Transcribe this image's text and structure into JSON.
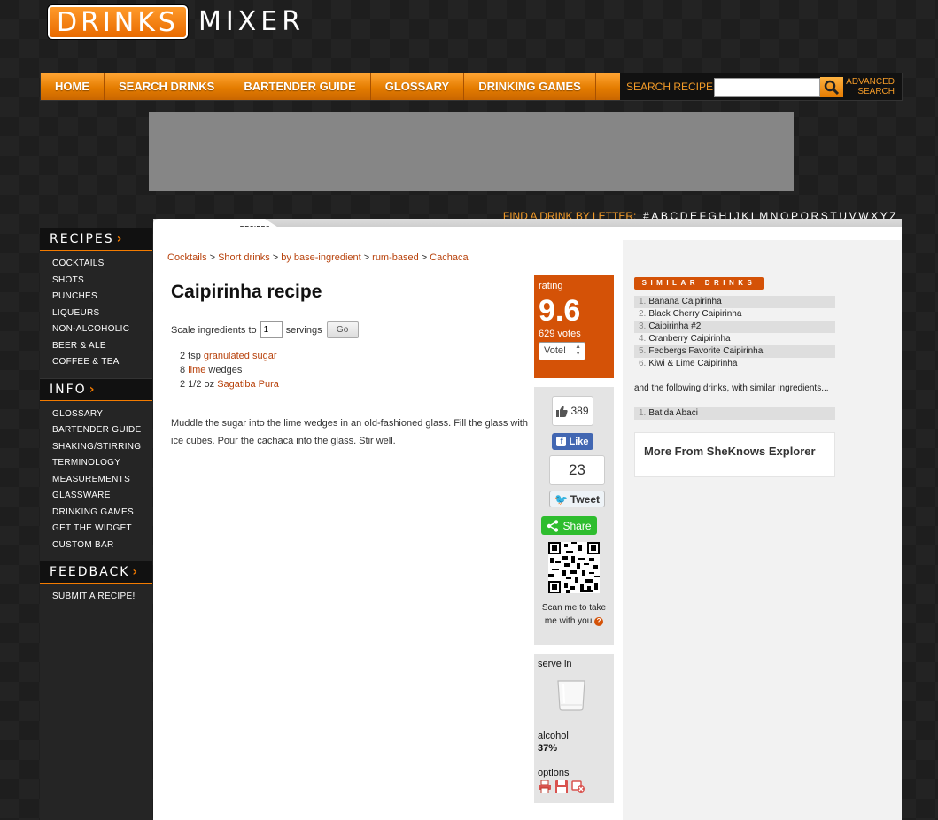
{
  "logo": {
    "part1": "DRINKS",
    "part2": "MIXER"
  },
  "nav": {
    "items": [
      "HOME",
      "SEARCH DRINKS",
      "BARTENDER GUIDE",
      "GLOSSARY",
      "DRINKING GAMES"
    ],
    "search_label": "SEARCH RECIPES",
    "search_placeholder": "",
    "advanced_line1": "ADVANCED",
    "advanced_line2": "SEARCH"
  },
  "letters": {
    "label": "FIND A DRINK BY LETTER:",
    "items": [
      "#",
      "A",
      "B",
      "C",
      "D",
      "E",
      "F",
      "G",
      "H",
      "I",
      "J",
      "K",
      "L",
      "M",
      "N",
      "O",
      "P",
      "Q",
      "R",
      "S",
      "T",
      "U",
      "V",
      "W",
      "X",
      "Y",
      "Z"
    ]
  },
  "sidebar": {
    "recipes": {
      "title": "RECIPES",
      "items": [
        "COCKTAILS",
        "SHOTS",
        "PUNCHES",
        "LIQUEURS",
        "NON-ALCOHOLIC",
        "BEER & ALE",
        "COFFEE & TEA"
      ]
    },
    "info": {
      "title": "INFO",
      "items": [
        "GLOSSARY",
        "BARTENDER GUIDE",
        "SHAKING/STIRRING",
        "TERMINOLOGY",
        "MEASUREMENTS",
        "GLASSWARE",
        "DRINKING GAMES",
        "GET THE WIDGET",
        "CUSTOM BAR"
      ]
    },
    "feedback": {
      "title": "FEEDBACK",
      "items": [
        "SUBMIT A RECIPE!"
      ]
    }
  },
  "tab": {
    "label": "RECIPES"
  },
  "breadcrumb": [
    "Cocktails",
    "Short drinks",
    "by base-ingredient",
    "rum-based",
    "Cachaca"
  ],
  "recipe": {
    "title": "Caipirinha recipe",
    "scale_prefix": "Scale ingredients to",
    "servings_value": "1",
    "scale_suffix": "servings",
    "go_label": "Go",
    "ingredients": [
      {
        "amount": "2 tsp",
        "name": "granulated sugar",
        "suffix": ""
      },
      {
        "amount": "8",
        "name": "lime",
        "suffix": "wedges"
      },
      {
        "amount": "2 1/2 oz",
        "name": "Sagatiba Pura",
        "suffix": ""
      }
    ],
    "instructions": "Muddle the sugar into the lime wedges in an old-fashioned glass. Fill the glass with ice cubes. Pour the cachaca into the glass. Stir well."
  },
  "rating": {
    "label": "rating",
    "value": "9.6",
    "votes": "629 votes",
    "vote_label": "Vote!"
  },
  "social": {
    "fb_count": "389",
    "fb_like": "Like",
    "tw_count": "23",
    "tw_label": "Tweet",
    "share_label": "Share",
    "scan_text": "Scan me to take me with you",
    "help_glyph": "?"
  },
  "serve": {
    "serve_label": "serve in",
    "alcohol_label": "alcohol",
    "alcohol_value": "37%",
    "options_label": "options"
  },
  "similar": {
    "title": "SIMILAR DRINKS",
    "items": [
      "Banana Caipirinha",
      "Black Cherry Caipirinha",
      "Caipirinha #2",
      "Cranberry Caipirinha",
      "Fedbergs Favorite Caipirinha",
      "Kiwi & Lime Caipirinha"
    ],
    "note": "and the following drinks, with similar ingredients...",
    "items2": [
      "Batida Abaci"
    ]
  },
  "more": {
    "title": "More From SheKnows Explorer"
  },
  "colors": {
    "accent": "#d45207",
    "nav_orange": "#e47c00",
    "link": "#b8420c"
  }
}
